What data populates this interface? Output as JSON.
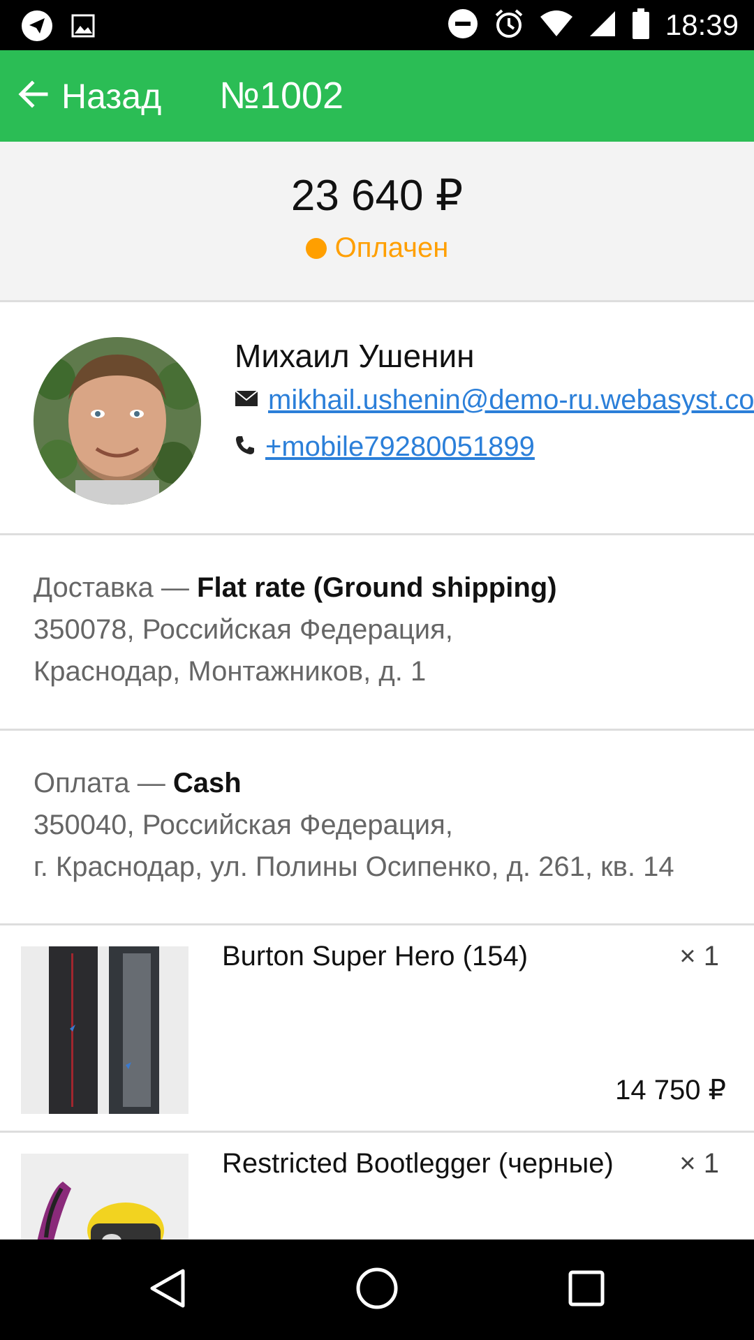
{
  "status_bar": {
    "time": "18:39",
    "icons": [
      "telegram-icon",
      "image-icon",
      "do-not-disturb-icon",
      "alarm-icon",
      "wifi-icon",
      "signal-icon",
      "battery-icon"
    ]
  },
  "app_bar": {
    "back_label": "Назад",
    "title": "№1002",
    "color": "#2bbd55"
  },
  "summary": {
    "total": "23 640 ₽",
    "status": "Оплачен",
    "status_color": "#ff9f00"
  },
  "customer": {
    "name": "Михаил Ушенин",
    "email": "mikhail.ushenin@demo-ru.webasyst.com",
    "phone": "+mobile79280051899"
  },
  "shipping": {
    "label": "Доставка — ",
    "method": "Flat rate (Ground shipping)",
    "address_line1": "350078, Российская Федерация,",
    "address_line2": "Краснодар, Монтажников, д. 1"
  },
  "payment": {
    "label": "Оплата — ",
    "method": "Cash",
    "address_line1": "350040, Российская Федерация,",
    "address_line2": "г. Краснодар, ул. Полины Осипенко, д. 261, кв. 14"
  },
  "items": [
    {
      "name": "Burton Super Hero (154)",
      "qty": "× 1",
      "price": "14 750 ₽"
    },
    {
      "name": "Restricted Bootlegger (черные)",
      "qty": "× 1"
    }
  ]
}
